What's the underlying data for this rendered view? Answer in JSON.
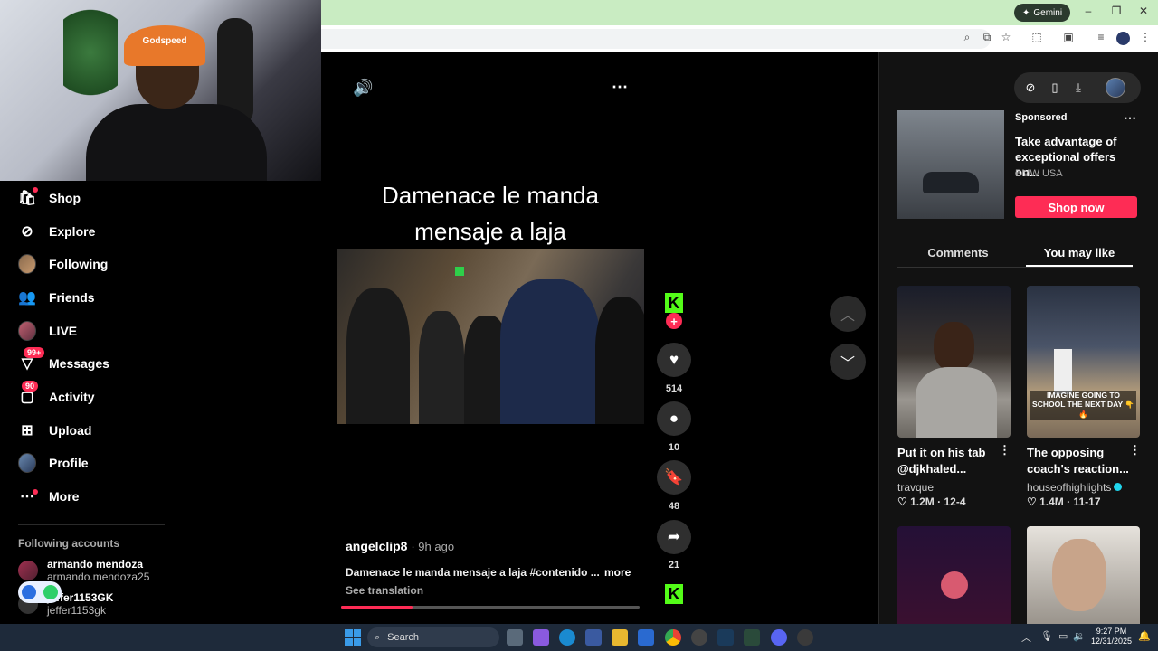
{
  "browser": {
    "gemini_label": "Gemini",
    "window_controls": [
      "–",
      "❐",
      "✕"
    ]
  },
  "webcam": {
    "cap_text": "Godspeed"
  },
  "sidebar": {
    "items": [
      {
        "label": "Shop",
        "icon": "shopping-bag-icon"
      },
      {
        "label": "Explore",
        "icon": "compass-icon"
      },
      {
        "label": "Following",
        "icon": "avatar"
      },
      {
        "label": "Friends",
        "icon": "friends-icon"
      },
      {
        "label": "LIVE",
        "icon": "avatar"
      },
      {
        "label": "Messages",
        "icon": "messages-icon",
        "badge": "99+"
      },
      {
        "label": "Activity",
        "icon": "activity-icon",
        "badge": "90"
      },
      {
        "label": "Upload",
        "icon": "upload-icon"
      },
      {
        "label": "Profile",
        "icon": "avatar"
      },
      {
        "label": "More",
        "icon": "more-icon"
      }
    ],
    "following_header": "Following accounts",
    "accounts": [
      {
        "name": "armando mendoza",
        "handle": "armando.mendoza25"
      },
      {
        "name": "jeffer1153GK",
        "handle": "jeffer1153gk"
      }
    ]
  },
  "video": {
    "title_line1": "Damenace  le manda",
    "title_line2": "mensaje a laja",
    "author": "angelclip8",
    "time": "· 9h ago",
    "caption": "Damenace le manda mensaje a laja #contenido ...",
    "more": "more",
    "see_translation": "See translation",
    "progress": 0.24,
    "likes": "514",
    "comments": "10",
    "saves": "48",
    "shares": "21"
  },
  "right_panel": {
    "sponsored_label": "Sponsored",
    "ad_title": "Take advantage of exceptional offers on...",
    "ad_brand": "BMW USA",
    "shop_now": "Shop now",
    "tabs": [
      "Comments",
      "You may like"
    ],
    "active_tab": 1,
    "recommendations": [
      {
        "title": "Put it on his tab @djkhaled...",
        "author": "travque",
        "views": "1.2M",
        "date": "12-4",
        "verified": false
      },
      {
        "title": "The opposing coach's reaction...",
        "author": "houseofhighlights",
        "views": "1.4M",
        "date": "11-17",
        "verified": true,
        "overlay": "IMAGINE GOING TO SCHOOL THE NEXT DAY 👇 🔥"
      }
    ]
  },
  "taskbar": {
    "search_placeholder": "Search",
    "time": "9:27 PM",
    "date": "12/31/2025"
  },
  "colors": {
    "accent": "#fe2c55",
    "kick_green": "#53fc18",
    "titlebar": "#c9ecc2"
  }
}
